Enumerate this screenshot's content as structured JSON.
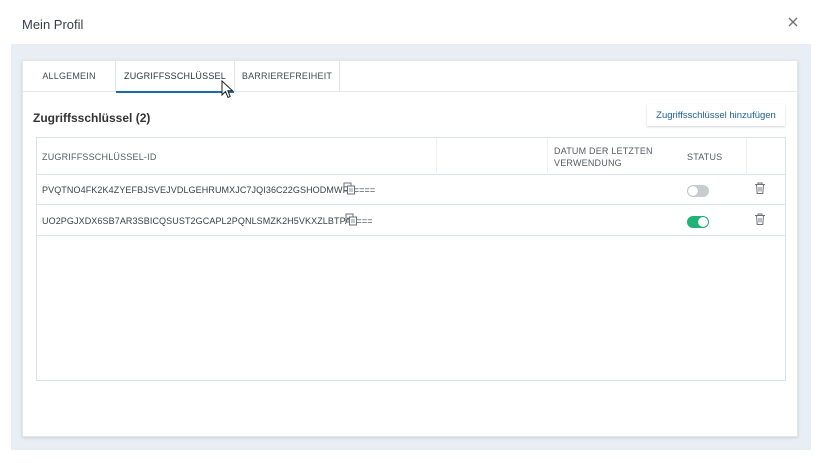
{
  "dialog": {
    "title": "Mein Profil"
  },
  "tabs": [
    {
      "label": "ALLGEMEIN",
      "active": false
    },
    {
      "label": "ZUGRIFFSSCHLÜSSEL",
      "active": true
    },
    {
      "label": "BARRIEREFREIHEIT",
      "active": false
    }
  ],
  "section": {
    "title": "Zugriffsschlüssel (2)",
    "add_button_label": "Zugriffsschlüssel hinzufügen"
  },
  "table": {
    "headers": {
      "key_id": "ZUGRIFFSSCHLÜSSEL-ID",
      "last_used": "DATUM DER LETZTEN VERWENDUNG",
      "status": "STATUS"
    },
    "rows": [
      {
        "key": "PVQTNO4FK2K4ZYEFBJSVEJVDLGEHRUMXJC7JQI36C22GSHODMWFA====",
        "last_used": "",
        "status": "off"
      },
      {
        "key": "UO2PGJXDX6SB7AR3SBICQSUST2GCAPL2PQNLSMZK2H5VKXZLBTPA====",
        "last_used": "",
        "status": "on"
      }
    ]
  },
  "icons": {
    "close": "close-icon",
    "copy": "copy-icon",
    "delete": "trash-icon",
    "cursor": "mouse-pointer-icon"
  },
  "colors": {
    "accent": "#1a6aa6",
    "toggle_on": "#1fb37a",
    "toggle_off": "#c7ccd1",
    "backdrop": "#e8eef3"
  }
}
